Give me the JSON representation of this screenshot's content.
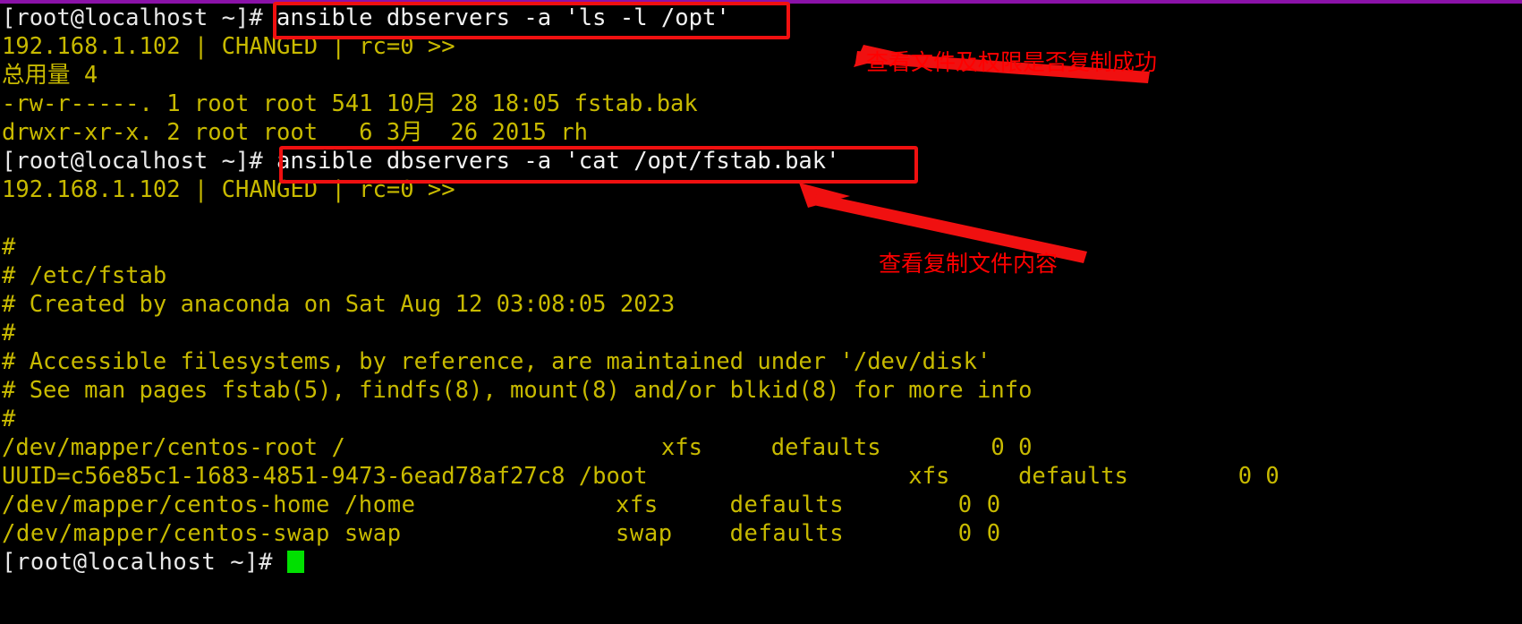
{
  "window": {
    "chrome_color": "#8b12a8",
    "background_color": "#000000",
    "foreground_color": "#c8ba00",
    "prompt_color": "#e8e8e8",
    "annotation_color": "#ff0000",
    "cursor_color": "#00e000"
  },
  "prompt": {
    "text": "[root@localhost ~]# "
  },
  "commands": {
    "cmd1": "ansible dbservers -a 'ls -l /opt'",
    "cmd2": "ansible dbservers -a 'cat /opt/fstab.bak'"
  },
  "lines": [
    {
      "id": "line-1",
      "type": "prompt-command",
      "prompt": "[root@localhost ~]# ",
      "command": "ansible dbservers -a 'ls -l /opt'"
    },
    {
      "id": "line-2",
      "type": "output",
      "text": "192.168.1.102 | CHANGED | rc=0 >>"
    },
    {
      "id": "line-3",
      "type": "output",
      "text": "总用量 4"
    },
    {
      "id": "line-4",
      "type": "output",
      "text": "-rw-r-----. 1 root root 541 10月 28 18:05 fstab.bak"
    },
    {
      "id": "line-5",
      "type": "output",
      "text": "drwxr-xr-x. 2 root root   6 3月  26 2015 rh"
    },
    {
      "id": "line-6",
      "type": "prompt-command",
      "prompt": "[root@localhost ~]# ",
      "command": "ansible dbservers -a 'cat /opt/fstab.bak'"
    },
    {
      "id": "line-7",
      "type": "output",
      "text": "192.168.1.102 | CHANGED | rc=0 >>"
    },
    {
      "id": "line-8",
      "type": "blank",
      "text": " "
    },
    {
      "id": "line-9",
      "type": "output",
      "text": "#"
    },
    {
      "id": "line-10",
      "type": "output",
      "text": "# /etc/fstab"
    },
    {
      "id": "line-11",
      "type": "output",
      "text": "# Created by anaconda on Sat Aug 12 03:08:05 2023"
    },
    {
      "id": "line-12",
      "type": "output",
      "text": "#"
    },
    {
      "id": "line-13",
      "type": "output",
      "text": "# Accessible filesystems, by reference, are maintained under '/dev/disk'"
    },
    {
      "id": "line-14",
      "type": "output",
      "text": "# See man pages fstab(5), findfs(8), mount(8) and/or blkid(8) for more info"
    },
    {
      "id": "line-15",
      "type": "output",
      "text": "#"
    },
    {
      "id": "line-16",
      "type": "output",
      "text": "/dev/mapper/centos-root /                       xfs     defaults        0 0"
    },
    {
      "id": "line-17",
      "type": "output",
      "text": "UUID=c56e85c1-1683-4851-9473-6ead78af27c8 /boot                   xfs     defaults        0 0"
    },
    {
      "id": "line-18",
      "type": "output-wide",
      "text": "/dev/mapper/centos-home /home              xfs     defaults        0 0"
    },
    {
      "id": "line-19",
      "type": "output-wide",
      "text": "/dev/mapper/centos-swap swap               swap    defaults        0 0"
    },
    {
      "id": "line-20",
      "type": "prompt-cursor",
      "prompt": "[root@localhost ~]# "
    }
  ],
  "annotations": [
    {
      "id": "annot-1",
      "text": "查看文件及权限是否复制成功"
    },
    {
      "id": "annot-2",
      "text": "查看复制文件内容"
    }
  ],
  "highlight_boxes": [
    {
      "id": "redbox-cmd1",
      "target": "ansible dbservers -a 'ls -l /opt'"
    },
    {
      "id": "redbox-cmd2",
      "target": "ansible dbservers -a 'cat /opt/fstab.bak'"
    }
  ]
}
